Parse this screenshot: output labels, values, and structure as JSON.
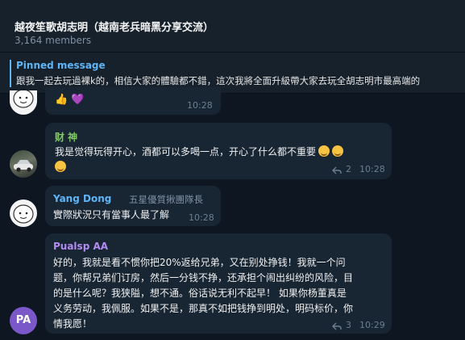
{
  "header": {
    "title": "越夜笙歌胡志明（越南老兵暗黑分享交流）",
    "members": "3,164 members"
  },
  "pinned": {
    "label": "Pinned message",
    "text": "跟我一起去玩過裸k的，相信大家的體驗都不錯，這次我將全面升級帶大家去玩全胡志明市最高端的"
  },
  "messages": [
    {
      "time": "10:28",
      "reactions": [
        "thumbs-up",
        "purple-heart"
      ]
    },
    {
      "sender": "财 神",
      "text": "我是觉得玩得开心，酒都可以多喝一点，开心了什么都不重要",
      "replies": "2",
      "time": "10:28"
    },
    {
      "sender": "Yang Dong",
      "role": "五星優質揪團隊長",
      "text": "實際狀況只有當事人最了解",
      "time": "10:28"
    },
    {
      "sender": "Pualsp AA",
      "avatar_initials": "PA",
      "lines": [
        "好的，我就是看不惯你把20%返给兄弟，又在别处挣钱！我就一个问",
        "题，你帮兄弟们订房，然后一分钱不挣，还承担个闹出纠纷的风险，目",
        "的是什么呢？我狭隘，想不通。俗话说无利不起早！ 如果你杨董真是",
        "义务劳动，我佩服。如果不是，那真不如把钱挣到明处，明码标价，你",
        "情我愿！"
      ],
      "replies": "3",
      "time": "10:29"
    }
  ],
  "colors": {
    "accent": "#5eb5f7",
    "sender_caishen": "#7fcb61",
    "sender_yang": "#5eb5f7",
    "sender_pualsp": "#b48cf2"
  }
}
